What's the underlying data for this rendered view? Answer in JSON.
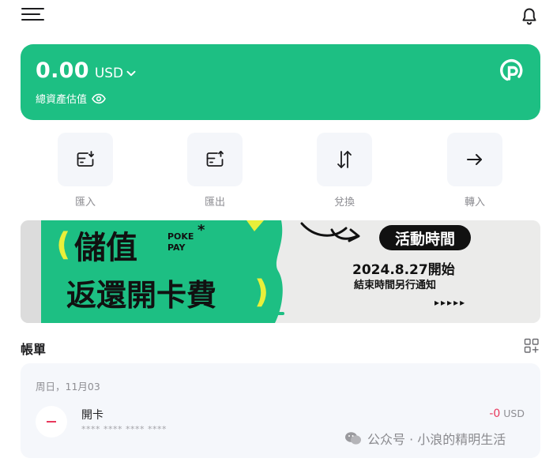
{
  "header": {
    "menu_icon": "hamburger-menu-icon",
    "notification_icon": "bell-icon"
  },
  "balance": {
    "amount": "0.00",
    "currency": "USD",
    "caption": "總資產估值",
    "brand_icon": "pokepay-logo-icon",
    "bg_color": "#1dbf83"
  },
  "actions": [
    {
      "label": "匯入",
      "icon": "deposit-icon"
    },
    {
      "label": "匯出",
      "icon": "withdraw-icon"
    },
    {
      "label": "兌換",
      "icon": "exchange-icon"
    },
    {
      "label": "轉入",
      "icon": "transfer-arrow-icon"
    }
  ],
  "banner": {
    "headline_1": "儲值",
    "brand_line_1": "POKE",
    "brand_line_2": "PAY",
    "headline_2": "返還開卡費",
    "badge": "活動時間",
    "date": "2024.8.27開始",
    "note": "結束時間另行通知",
    "arrows": "▸▸▸▸▸"
  },
  "bills": {
    "title": "帳單",
    "date_label": "周日，11月03",
    "items": [
      {
        "name": "開卡",
        "card_mask": "**** **** **** ****",
        "amount": "-0",
        "currency": "USD"
      }
    ]
  },
  "watermark": {
    "text": "公众号 · 小浪的精明生活"
  },
  "colors": {
    "accent": "#1dbf83",
    "negative": "#e8385c",
    "tile_bg": "#f4f6fa"
  }
}
